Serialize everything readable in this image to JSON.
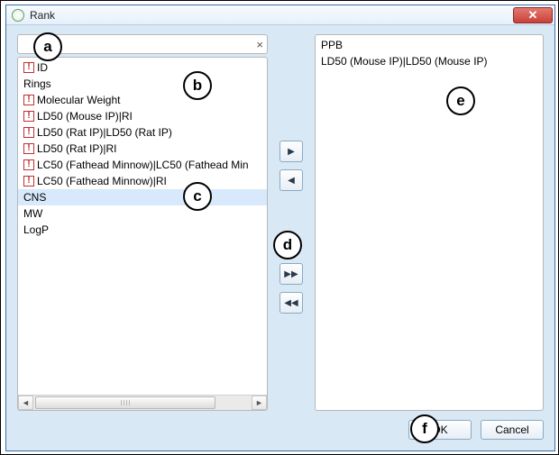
{
  "window": {
    "title": "Rank",
    "close_glyph": "✕"
  },
  "search": {
    "value": "",
    "placeholder": "",
    "clear_glyph": "×"
  },
  "left_list": {
    "items": [
      {
        "label": "ID",
        "warn": true,
        "selected": false
      },
      {
        "label": "Rings",
        "warn": false,
        "selected": false
      },
      {
        "label": "Molecular Weight",
        "warn": true,
        "selected": false
      },
      {
        "label": "LD50 (Mouse IP)|RI",
        "warn": true,
        "selected": false
      },
      {
        "label": "LD50 (Rat IP)|LD50 (Rat IP)",
        "warn": true,
        "selected": false
      },
      {
        "label": "LD50 (Rat IP)|RI",
        "warn": true,
        "selected": false
      },
      {
        "label": "LC50 (Fathead Minnow)|LC50 (Fathead Min",
        "warn": true,
        "selected": false
      },
      {
        "label": "LC50 (Fathead Minnow)|RI",
        "warn": true,
        "selected": false
      },
      {
        "label": "CNS",
        "warn": false,
        "selected": true
      },
      {
        "label": "MW",
        "warn": false,
        "selected": false
      },
      {
        "label": "LogP",
        "warn": false,
        "selected": false
      }
    ]
  },
  "right_list": {
    "items": [
      {
        "label": "PPB"
      },
      {
        "label": "LD50 (Mouse IP)|LD50 (Mouse IP)"
      }
    ]
  },
  "move_buttons": {
    "add": "▶",
    "remove": "◀",
    "add_all": "▶▶",
    "remove_all": "◀◀"
  },
  "buttons": {
    "ok": "OK",
    "cancel": "Cancel"
  },
  "callouts": {
    "a": "a",
    "b": "b",
    "c": "c",
    "d": "d",
    "e": "e",
    "f": "f"
  }
}
